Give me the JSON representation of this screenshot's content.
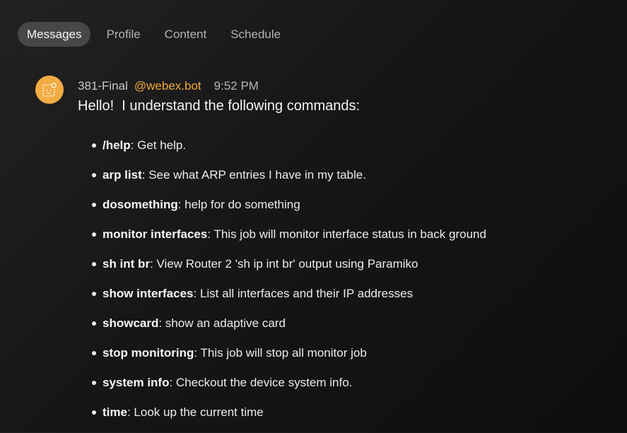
{
  "tabs": [
    {
      "label": "Messages",
      "active": true
    },
    {
      "label": "Profile",
      "active": false
    },
    {
      "label": "Content",
      "active": false
    },
    {
      "label": "Schedule",
      "active": false
    }
  ],
  "message": {
    "sender": "381-Final",
    "mention": "@webex.bot",
    "time": "9:52 PM",
    "intro": "Hello!  I understand the following commands:",
    "avatar_icon": "bot-avatar-icon",
    "avatar_color": "#f2ac44",
    "mention_color": "#f2a93b",
    "commands": [
      {
        "name": "/help",
        "desc": ": Get help."
      },
      {
        "name": "arp list",
        "desc": ": See what ARP entries I have in my table."
      },
      {
        "name": "dosomething",
        "desc": ": help for do something"
      },
      {
        "name": "monitor interfaces",
        "desc": ": This job will monitor interface status in back ground"
      },
      {
        "name": "sh int br",
        "desc": ": View Router 2 'sh ip int br' output using Paramiko"
      },
      {
        "name": "show interfaces",
        "desc": ": List all interfaces and their IP addresses"
      },
      {
        "name": "showcard",
        "desc": ": show an adaptive card"
      },
      {
        "name": "stop monitoring",
        "desc": ": This job will stop all monitor job"
      },
      {
        "name": "system info",
        "desc": ": Checkout the device system info."
      },
      {
        "name": "time",
        "desc": ": Look up the current time"
      }
    ]
  }
}
